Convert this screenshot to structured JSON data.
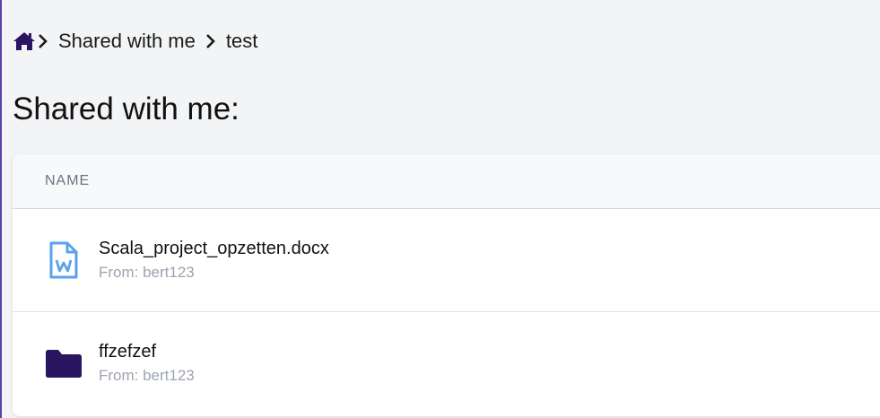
{
  "breadcrumb": {
    "home_icon": "home-icon",
    "items": [
      {
        "label": "Shared with me"
      },
      {
        "label": "test"
      }
    ],
    "separator_icon": "chevron-right-icon"
  },
  "page": {
    "title": "Shared with me:"
  },
  "table": {
    "header_name": "NAME",
    "rows": [
      {
        "name": "Scala_project_opzetten.docx",
        "from": "From: bert123",
        "icon": "word-file-icon"
      },
      {
        "name": "ffzefzef",
        "from": "From: bert123",
        "icon": "folder-icon"
      }
    ]
  },
  "colors": {
    "accent": "#2a1660",
    "word_icon": "#5aa2ee",
    "left_border": "#5b3fa8"
  }
}
